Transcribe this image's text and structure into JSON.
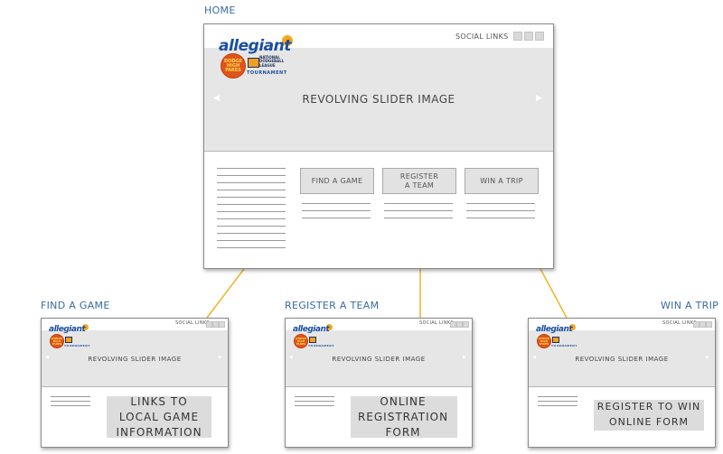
{
  "labels": {
    "home": "HOME",
    "find_a_game": "FIND A GAME",
    "register_a_team": "REGISTER A TEAM",
    "win_a_trip": "WIN A TRIP"
  },
  "header": {
    "social_links": "SOCIAL LINKS"
  },
  "logo": {
    "word": "allegiant",
    "seal_line1": "DODGE",
    "seal_line2": "HIGH",
    "seal_line3": "FARES",
    "league_line1": "NATIONAL",
    "league_line2": "DODGEBALL",
    "league_line3": "LEAGUE",
    "tournament": "TOURNAMENT"
  },
  "slider": {
    "text": "REVOLVING SLIDER IMAGE",
    "prev_icon": "◀",
    "next_icon": "▶"
  },
  "home_buttons": [
    {
      "line1": "FIND A GAME",
      "line2": ""
    },
    {
      "line1": "REGISTER",
      "line2": "A TEAM"
    },
    {
      "line1": "WIN A TRIP",
      "line2": ""
    }
  ],
  "subpages": {
    "find_a_game": {
      "line1": "LINKS TO",
      "line2": "LOCAL GAME",
      "line3": "INFORMATION"
    },
    "register_a_team": {
      "line1": "ONLINE",
      "line2": "REGISTRATION",
      "line3": "FORM"
    },
    "win_a_trip": {
      "line1": "REGISTER TO WIN",
      "line2": "ONLINE FORM"
    }
  },
  "colors": {
    "connector": "#f0b428",
    "label_blue": "#3a6aa3",
    "brand_blue": "#1b4fa0"
  }
}
